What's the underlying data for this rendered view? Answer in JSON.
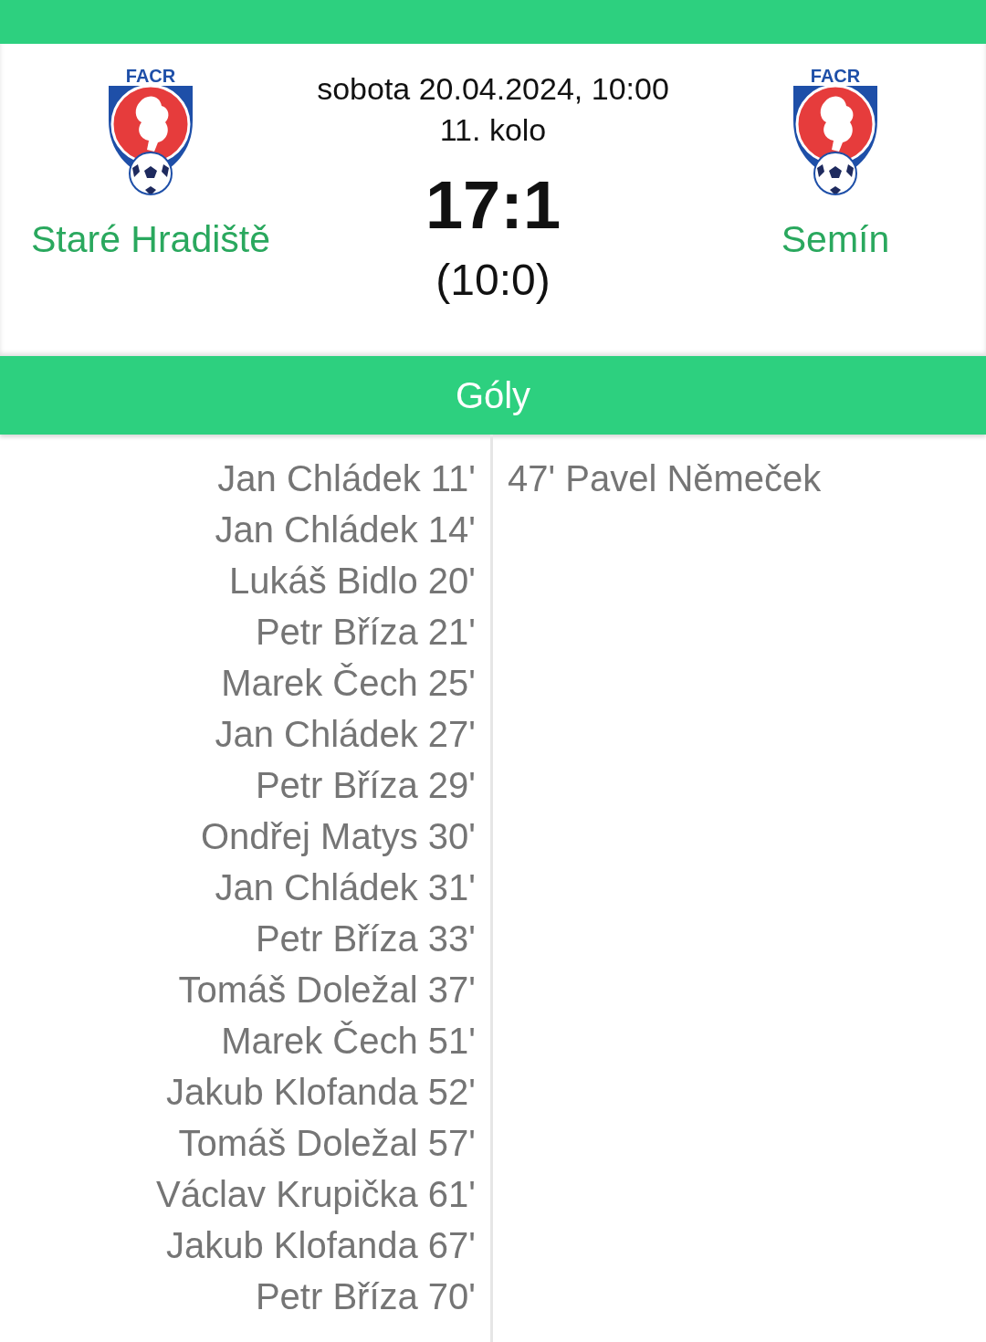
{
  "match": {
    "date": "sobota 20.04.2024, 10:00",
    "round": "11. kolo",
    "score": "17:1",
    "halftime": "(10:0)",
    "home": {
      "name": "Staré Hradiště",
      "logo_text": "FACR"
    },
    "away": {
      "name": "Semín",
      "logo_text": "FACR"
    }
  },
  "section_title": "Góly",
  "goals": {
    "home": [
      "Jan Chládek 11'",
      "Jan Chládek 14'",
      "Lukáš Bidlo 20'",
      "Petr Bříza 21'",
      "Marek Čech 25'",
      "Jan Chládek 27'",
      "Petr Bříza 29'",
      "Ondřej Matys 30'",
      "Jan Chládek 31'",
      "Petr Bříza 33'",
      "Tomáš Doležal 37'",
      "Marek Čech 51'",
      "Jakub Klofanda 52'",
      "Tomáš Doležal 57'",
      "Václav Krupička 61'",
      "Jakub Klofanda 67'",
      "Petr Bříza 70'"
    ],
    "away": [
      "47' Pavel Němeček"
    ]
  }
}
